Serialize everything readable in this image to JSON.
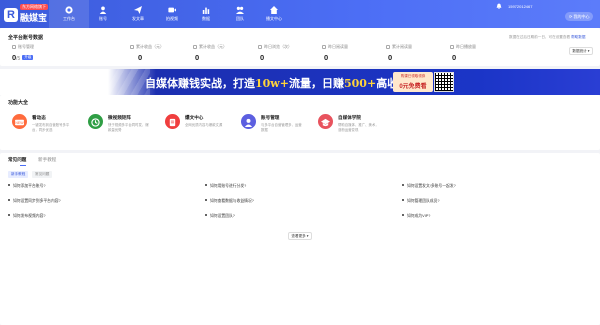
{
  "brand": {
    "badge": "东方网络旗下",
    "name": "融媒宝"
  },
  "nav": [
    {
      "label": "工作台",
      "icon": "dashboard-icon",
      "active": true
    },
    {
      "label": "账号",
      "icon": "user-icon"
    },
    {
      "label": "发文章",
      "icon": "send-icon"
    },
    {
      "label": "拍视频",
      "icon": "video-icon"
    },
    {
      "label": "数据",
      "icon": "chart-icon"
    },
    {
      "label": "团队",
      "icon": "team-icon"
    },
    {
      "label": "播文中心",
      "icon": "home-icon"
    }
  ],
  "header": {
    "phone": "15972012467",
    "switch_label": "我的中心"
  },
  "overview": {
    "title": "全平台账号数据",
    "hint_prefix": "数据在过后日期前一日，可在设置查看",
    "hint_link": "帮助数据",
    "select_label": "数据统计",
    "stats": [
      {
        "label": "账号管理",
        "value": "0",
        "suffix": "/5",
        "tag": "升级"
      },
      {
        "label": "累计收益（元）",
        "value": "0"
      },
      {
        "label": "累计收益（元）",
        "value": "0"
      },
      {
        "label": "昨日浏览（次）",
        "value": "0"
      },
      {
        "label": "昨日阅读量",
        "value": "0"
      },
      {
        "label": "累计阅读量",
        "value": "0"
      },
      {
        "label": "昨日播放量",
        "value": "0"
      }
    ]
  },
  "banner": {
    "text_a": "自媒体赚钱实战，打造",
    "text_b": "10w+",
    "text_c": "流量，日赚",
    "text_d": "500+",
    "text_e": "高收益玩法",
    "cta_top": "购课已领取领券",
    "cta_main": "0元免费看"
  },
  "functions": {
    "title": "功能大全",
    "items": [
      {
        "title": "看动态",
        "desc": "一键发布到自营账号多平台，同步优选",
        "icon": "new-icon",
        "color": "#ff6b3d"
      },
      {
        "title": "微视频矩阵",
        "desc": "快于视频多平台同时发，爆款量优势",
        "icon": "clock-icon",
        "color": "#2f9e44"
      },
      {
        "title": "爆文中心",
        "desc": "全网优质内容与爆款文源",
        "icon": "fire-icon",
        "color": "#f03e3e"
      },
      {
        "title": "账号管理",
        "desc": "与多平台自营管理多，运营数据",
        "icon": "account-icon",
        "color": "#5c5fe0"
      },
      {
        "title": "自媒体学院",
        "desc": "帮助自媒体、推广、美术，涨粉运营变现",
        "icon": "academy-icon",
        "color": "#e8535e"
      }
    ]
  },
  "help": {
    "tabs": [
      "常见问题",
      "新手教程"
    ],
    "subtabs": [
      "新手教程",
      "常见问题"
    ],
    "questions": [
      "如何添加平台账号?",
      "如何用账号进行分发?",
      "如何设置发文/多账号一起发?",
      "如何设置同步到多平台内容?",
      "如何查看数据与收益情况?",
      "如何管理团队成员?",
      "如何发布视频内容?",
      "如何设置团队?",
      "如何成为VIP?"
    ],
    "more_label": "查看更多"
  },
  "colors": {
    "primary": "#4c6ef5",
    "banner_bg": "#1b35c7",
    "accent": "#ffd43b"
  }
}
